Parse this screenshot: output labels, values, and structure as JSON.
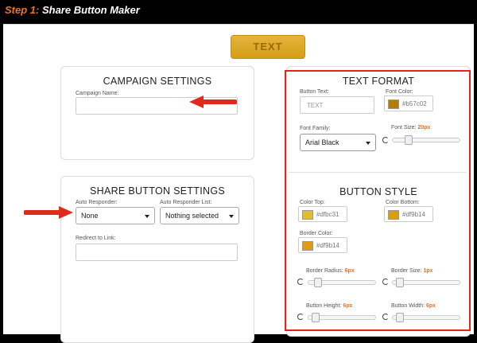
{
  "header": {
    "step": "Step 1:",
    "title": "Share Button Maker"
  },
  "preview": {
    "label": "TEXT"
  },
  "campaign": {
    "heading": "CAMPAIGN SETTINGS",
    "name_label": "Campaign Name:",
    "name_value": ""
  },
  "share": {
    "heading": "SHARE BUTTON SETTINGS",
    "auto_responder_label": "Auto Responder:",
    "auto_responder_value": "None",
    "auto_responder_list_label": "Auto Responder List:",
    "auto_responder_list_value": "Nothing selected",
    "redirect_label": "Redirect to Link:",
    "redirect_value": ""
  },
  "text_format": {
    "heading": "TEXT FORMAT",
    "button_text_label": "Button Text:",
    "button_text_placeholder": "TEXT",
    "font_color_label": "Font Color:",
    "font_color_value": "#b57c02",
    "font_family_label": "Font Family:",
    "font_family_value": "Arial Black",
    "font_size_label": "Font Size:",
    "font_size_value": "20px",
    "font_size_level": 0.2
  },
  "button_style": {
    "heading": "BUTTON STYLE",
    "color_top_label": "Color Top:",
    "color_top_value": "#dfbc31",
    "color_bottom_label": "Color Bottom:",
    "color_bottom_value": "#df9b14",
    "border_color_label": "Border Color:",
    "border_color_value": "#df9b14",
    "border_radius_label": "Border Radius:",
    "border_radius_value": "6px",
    "border_radius_level": 0.1,
    "border_size_label": "Border Size:",
    "border_size_value": "1px",
    "border_size_level": 0.05,
    "button_height_label": "Button Height:",
    "button_height_value": "6px",
    "button_height_level": 0.05,
    "button_width_label": "Button Width:",
    "button_width_value": "6px",
    "button_width_level": 0.05
  },
  "colors": {
    "accent_orange": "#e8752b",
    "highlight_red": "#e3241b",
    "arrow_red": "#e02a1c",
    "font_color_swatch": "#b57c02",
    "color_top_swatch": "#dfbc31",
    "color_bottom_swatch": "#df9b14",
    "border_color_swatch": "#df9b14"
  }
}
